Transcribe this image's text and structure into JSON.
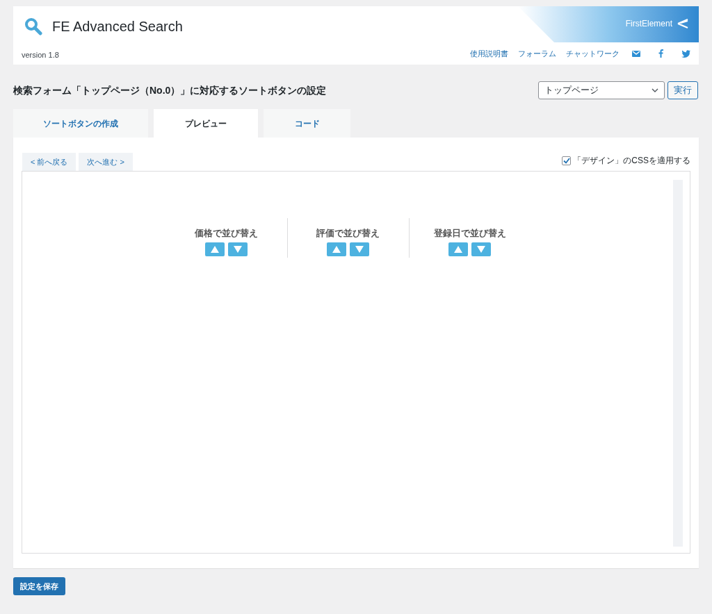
{
  "header": {
    "title": "FE Advanced Search",
    "version": "version 1.8",
    "brand": "FirstElement",
    "links": [
      "使用説明書",
      "フォーラム",
      "チャットワーク"
    ]
  },
  "page_title": "検索フォーム「トップページ（No.0）」に対応するソートボタンの設定",
  "form_select": {
    "value": "トップページ"
  },
  "run_button": "実行",
  "tabs": [
    {
      "label": "ソートボタンの作成",
      "selected": false
    },
    {
      "label": "プレビュー",
      "selected": true
    },
    {
      "label": "コード",
      "selected": false
    }
  ],
  "nav_buttons": [
    "< 前へ戻る",
    "次へ進む >"
  ],
  "apply_css": {
    "label": "「デザイン」のCSSを適用する",
    "checked": true
  },
  "sort_groups": [
    {
      "label": "価格で並び替え"
    },
    {
      "label": "評価で並び替え"
    },
    {
      "label": "登録日で並び替え"
    }
  ],
  "save_button": "設定を保存"
}
